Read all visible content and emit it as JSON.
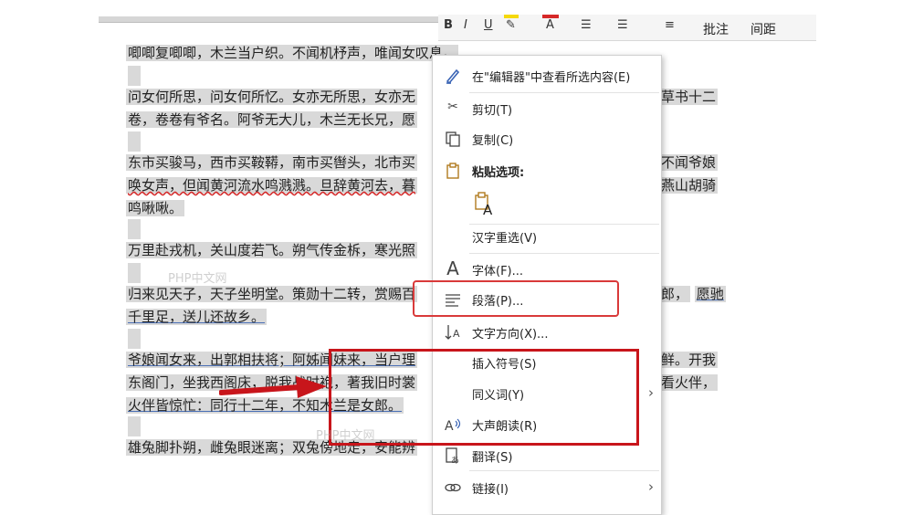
{
  "ribbon": {
    "tools": [
      "B",
      "I",
      "U"
    ],
    "btn_comment": "批注",
    "btn_spacing": "间距"
  },
  "document": {
    "paragraphs": [
      [
        "唧唧复唧唧，木兰当户织。不闻机杼声，唯闻女叹息。"
      ],
      [
        "问女何所思，问女何所忆。女亦无所思，女亦无",
        "卷，卷卷有爷名。阿爷无大儿，木兰无长兄，愿"
      ],
      [
        "东市买骏马，西市买鞍鞯，南市买辔头，北市买",
        "唤女声，但闻黄河流水鸣溅溅。旦辞黄河去，暮",
        "鸣啾啾。"
      ],
      [
        "万里赴戎机，关山度若飞。朔气传金柝，寒光照"
      ],
      [
        "归来见天子，天子坐明堂。策勋十二转，赏赐百",
        "千里足，送儿还故乡。"
      ],
      [
        "爷娘闻女来，出郭相扶将；阿姊闻妹来，当户理",
        "东阁门，坐我西阁床，脱我战时袍，著我旧时裳",
        "火伴皆惊忙：同行十二年，不知木兰是女郎。"
      ],
      [
        "雄兔脚扑朔，雌兔眼迷离；双兔傍地走，安能辨"
      ]
    ],
    "right_fragments": [
      "草书十二",
      "不闻爷娘",
      "燕山胡骑",
      "郎，",
      "愿驰",
      "鲜。开我",
      "看火伴，"
    ]
  },
  "context_menu": {
    "items": [
      {
        "icon": "pen-icon",
        "label": "在\"编辑器\"中查看所选内容(E)"
      },
      {
        "icon": "scissors-icon",
        "label": "剪切(T)"
      },
      {
        "icon": "copy-icon",
        "label": "复制(C)"
      },
      {
        "icon": "clipboard-icon",
        "label": "粘贴选项:"
      },
      {
        "icon": "",
        "label": "汉字重选(V)"
      },
      {
        "icon": "font-icon",
        "label": "字体(F)..."
      },
      {
        "icon": "paragraph-icon",
        "label": "段落(P)..."
      },
      {
        "icon": "text-direction-icon",
        "label": "文字方向(X)..."
      },
      {
        "icon": "",
        "label": "插入符号(S)"
      },
      {
        "icon": "",
        "label": "同义词(Y)"
      },
      {
        "icon": "read-aloud-icon",
        "label": "大声朗读(R)"
      },
      {
        "icon": "translate-icon",
        "label": "翻译(S)"
      },
      {
        "icon": "link-icon",
        "label": "链接(I)"
      }
    ],
    "paste_glyph": "A",
    "submenu_arrow": "›"
  },
  "watermark": "PHP中文网",
  "colors": {
    "annotation_red": "#c8151b",
    "selection_gray": "#d9d9d9"
  }
}
